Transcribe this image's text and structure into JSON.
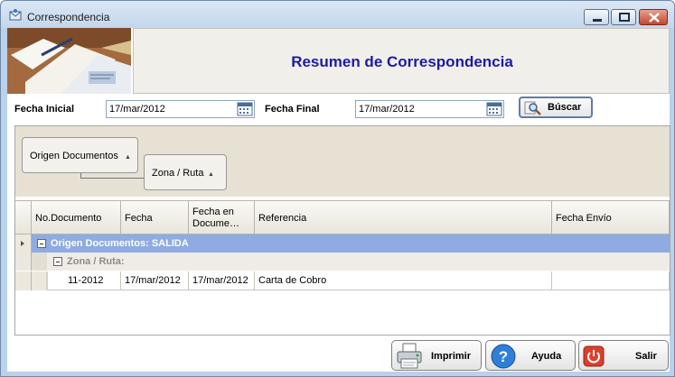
{
  "window": {
    "title": "Correspondencia"
  },
  "header": {
    "title": "Resumen de Correspondencia"
  },
  "filters": {
    "start_label": "Fecha Inicial",
    "start_value": "17/mar/2012",
    "end_label": "Fecha Final",
    "end_value": "17/mar/2012",
    "search_label": "Búscar"
  },
  "grouping": {
    "chips": [
      "Origen Documentos",
      "Zona / Ruta"
    ]
  },
  "grid": {
    "columns": [
      "No.Documento",
      "Fecha",
      "Fecha en Docume…",
      "Referencia",
      "Fecha Envío"
    ],
    "group1": "Origen Documentos: SALIDA",
    "group2": "Zona / Ruta:",
    "rows": [
      {
        "no_documento": "11-2012",
        "fecha": "17/mar/2012",
        "fecha_documento": "17/mar/2012",
        "referencia": "Carta de Cobro",
        "fecha_envio": ""
      }
    ]
  },
  "actions": {
    "print_label": "Imprimir",
    "help_label": "Ayuda",
    "exit_label": "Salir"
  },
  "colors": {
    "title_blue": "#1b1ba5",
    "group_row": "#8fabe1",
    "group_panel": "#e7e1d4"
  }
}
